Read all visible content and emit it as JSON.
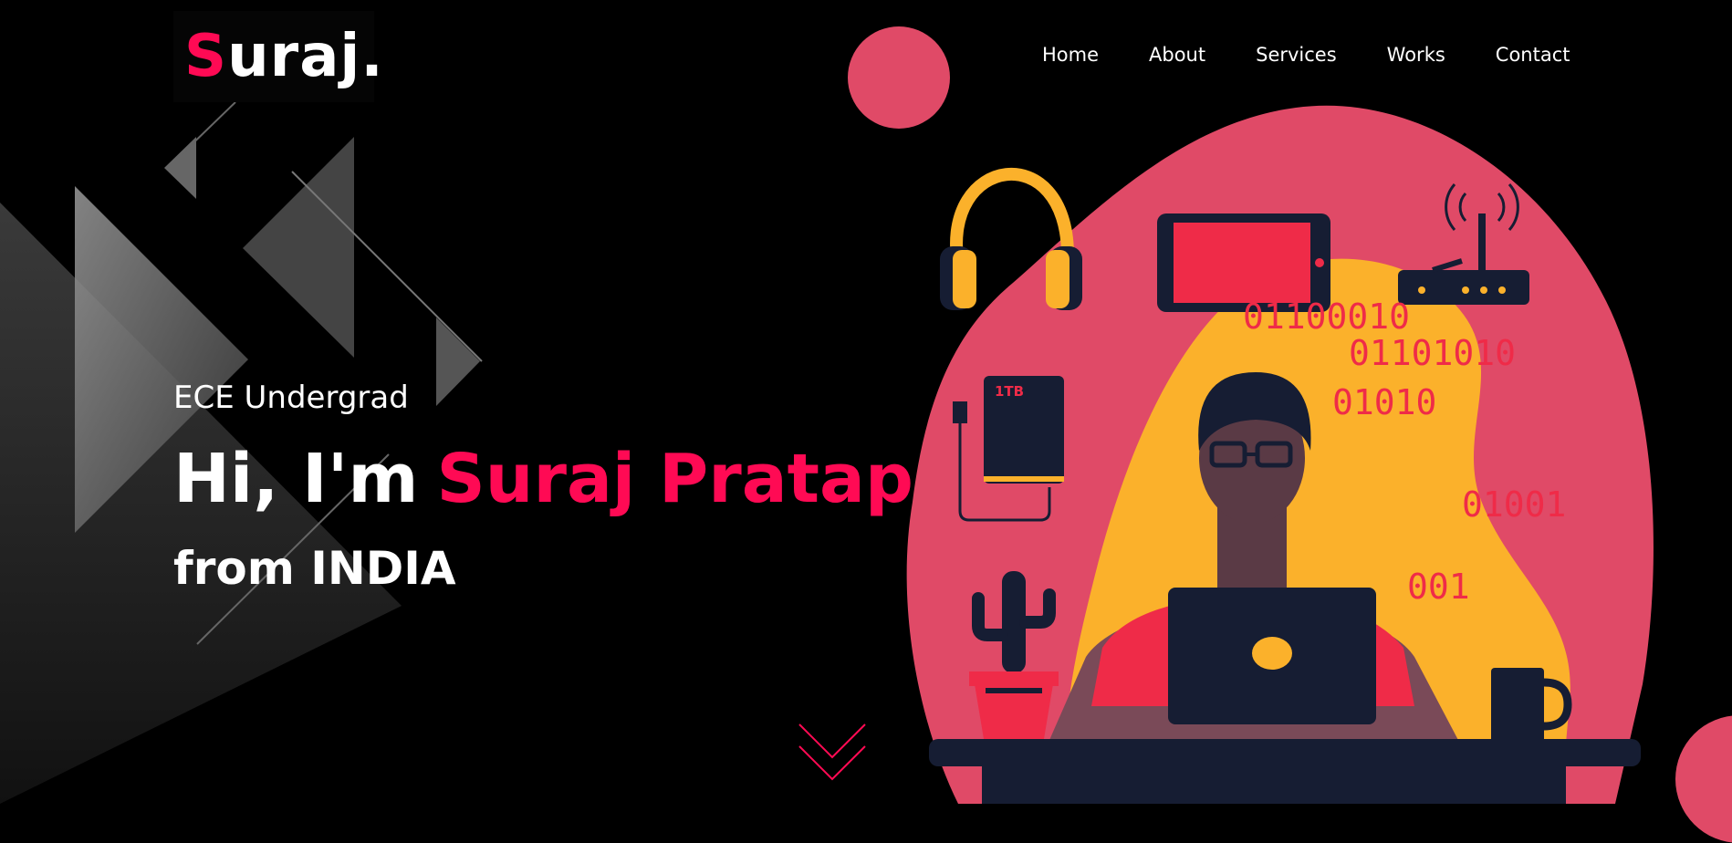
{
  "logo": {
    "first_letter": "S",
    "rest": "uraj."
  },
  "nav": {
    "items": [
      "Home",
      "About",
      "Services",
      "Works",
      "Contact"
    ]
  },
  "hero": {
    "subtitle": "ECE Undergrad",
    "greeting": "Hi, I'm",
    "typed_name": "Suraj Pratap...",
    "location": "from INDIA"
  },
  "illustration": {
    "binary_lines": [
      "01100010",
      "01101010",
      "01010",
      "01001",
      "001"
    ],
    "drive_label": "1TB"
  },
  "colors": {
    "accent": "#ff0a54",
    "blob_pink": "#e04a67",
    "blob_yellow": "#fbb12b",
    "navy": "#161d33"
  }
}
